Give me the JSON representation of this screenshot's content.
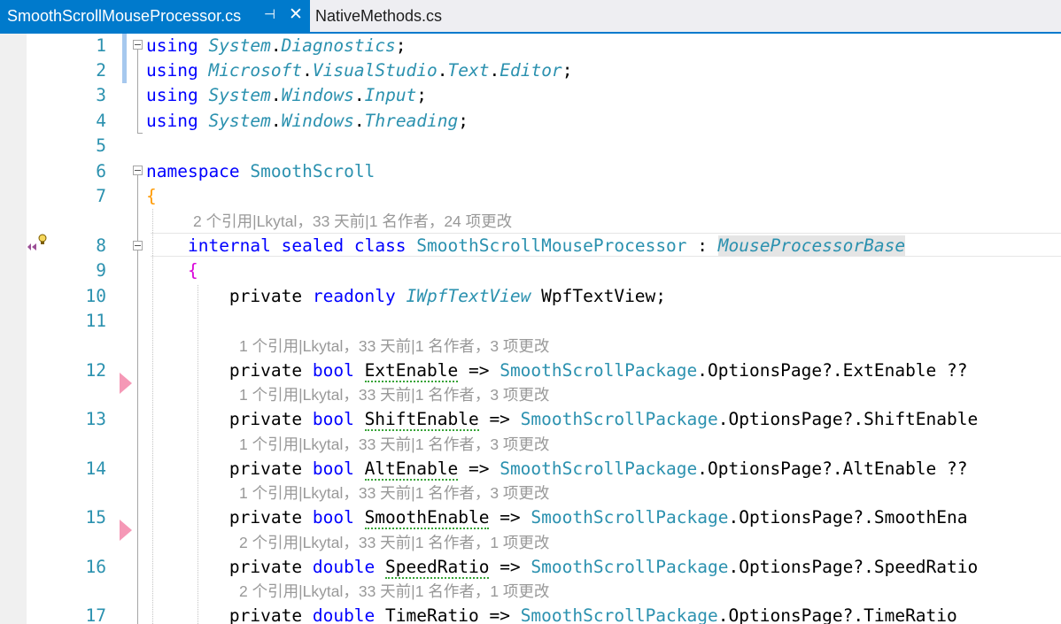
{
  "tabs": [
    {
      "label": "SmoothScrollMouseProcessor.cs",
      "active": true,
      "pin_icon": "pin-icon",
      "close_icon": "close-icon"
    },
    {
      "label": "NativeMethods.cs",
      "active": false
    }
  ],
  "colors": {
    "accent": "#007acc",
    "keyword": "#0000ff",
    "type": "#2b91af",
    "line_number": "#2b91af",
    "brace_namespace": "#ff9900",
    "brace_class": "#d900d9",
    "codelens": "#999999",
    "breakpoint": "#f598b6"
  },
  "codelens": {
    "class": "2 个引用|Lkytal，33 天前|1 名作者，24 项更改",
    "line12": "1 个引用|Lkytal，33 天前|1 名作者，3 项更改",
    "line13": "1 个引用|Lkytal，33 天前|1 名作者，3 项更改",
    "line14": "1 个引用|Lkytal，33 天前|1 名作者，3 项更改",
    "line15": "1 个引用|Lkytal，33 天前|1 名作者，3 项更改",
    "line16": "2 个引用|Lkytal，33 天前|1 名作者，1 项更改",
    "line17": "2 个引用|Lkytal，33 天前|1 名作者，1 项更改"
  },
  "lines": [
    {
      "n": "1",
      "tokens": [
        [
          "kw",
          "using"
        ],
        [
          "p",
          " "
        ],
        [
          "ns",
          "System"
        ],
        [
          "p",
          "."
        ],
        [
          "ns",
          "Diagnostics"
        ],
        [
          "p",
          ";"
        ]
      ]
    },
    {
      "n": "2",
      "tokens": [
        [
          "kw",
          "using"
        ],
        [
          "p",
          " "
        ],
        [
          "ns",
          "Microsoft"
        ],
        [
          "p",
          "."
        ],
        [
          "ns",
          "VisualStudio"
        ],
        [
          "p",
          "."
        ],
        [
          "ns",
          "Text"
        ],
        [
          "p",
          "."
        ],
        [
          "ns",
          "Editor"
        ],
        [
          "p",
          ";"
        ]
      ]
    },
    {
      "n": "3",
      "tokens": [
        [
          "kw",
          "using"
        ],
        [
          "p",
          " "
        ],
        [
          "ns",
          "System"
        ],
        [
          "p",
          "."
        ],
        [
          "ns",
          "Windows"
        ],
        [
          "p",
          "."
        ],
        [
          "ns",
          "Input"
        ],
        [
          "p",
          ";"
        ]
      ]
    },
    {
      "n": "4",
      "tokens": [
        [
          "kw",
          "using"
        ],
        [
          "p",
          " "
        ],
        [
          "ns",
          "System"
        ],
        [
          "p",
          "."
        ],
        [
          "ns",
          "Windows"
        ],
        [
          "p",
          "."
        ],
        [
          "ns",
          "Threading"
        ],
        [
          "p",
          ";"
        ]
      ]
    },
    {
      "n": "5",
      "tokens": []
    },
    {
      "n": "6",
      "tokens": [
        [
          "kw",
          "namespace"
        ],
        [
          "p",
          " "
        ],
        [
          "cls",
          "SmoothScroll"
        ]
      ]
    },
    {
      "n": "7",
      "tokens": [
        [
          "brace-o",
          "{"
        ]
      ]
    },
    {
      "n": "8",
      "tokens": [
        [
          "p",
          "    "
        ],
        [
          "kw",
          "internal"
        ],
        [
          "p",
          " "
        ],
        [
          "kw",
          "sealed"
        ],
        [
          "p",
          " "
        ],
        [
          "kw",
          "class"
        ],
        [
          "p",
          " "
        ],
        [
          "cls",
          "SmoothScrollMouseProcessor"
        ],
        [
          "p",
          " : "
        ],
        [
          "iface hl-base",
          "MouseProcessorBase"
        ]
      ]
    },
    {
      "n": "9",
      "tokens": [
        [
          "p",
          "    "
        ],
        [
          "brace-p",
          "{"
        ]
      ]
    },
    {
      "n": "10",
      "tokens": [
        [
          "p",
          "        private "
        ],
        [
          "kw",
          "readonly"
        ],
        [
          "p",
          " "
        ],
        [
          "iface",
          "IWpfTextView"
        ],
        [
          "p",
          " WpfTextView;"
        ]
      ]
    },
    {
      "n": "11",
      "tokens": []
    },
    {
      "n": "12",
      "tokens": [
        [
          "p",
          "        private "
        ],
        [
          "kw",
          "bool"
        ],
        [
          "p",
          " "
        ],
        [
          "squig",
          "ExtEnable"
        ],
        [
          "p",
          " => "
        ],
        [
          "cls",
          "SmoothScrollPackage"
        ],
        [
          "p",
          ".OptionsPage?.ExtEnable ??"
        ]
      ]
    },
    {
      "n": "13",
      "tokens": [
        [
          "p",
          "        private "
        ],
        [
          "kw",
          "bool"
        ],
        [
          "p",
          " "
        ],
        [
          "squig",
          "ShiftEnable"
        ],
        [
          "p",
          " => "
        ],
        [
          "cls",
          "SmoothScrollPackage"
        ],
        [
          "p",
          ".OptionsPage?.ShiftEnable"
        ]
      ]
    },
    {
      "n": "14",
      "tokens": [
        [
          "p",
          "        private "
        ],
        [
          "kw",
          "bool"
        ],
        [
          "p",
          " "
        ],
        [
          "squig",
          "AltEnable"
        ],
        [
          "p",
          " => "
        ],
        [
          "cls",
          "SmoothScrollPackage"
        ],
        [
          "p",
          ".OptionsPage?.AltEnable ??"
        ]
      ]
    },
    {
      "n": "15",
      "tokens": [
        [
          "p",
          "        private "
        ],
        [
          "kw",
          "bool"
        ],
        [
          "p",
          " "
        ],
        [
          "squig",
          "SmoothEnable"
        ],
        [
          "p",
          " => "
        ],
        [
          "cls",
          "SmoothScrollPackage"
        ],
        [
          "p",
          ".OptionsPage?.SmoothEna"
        ]
      ]
    },
    {
      "n": "16",
      "tokens": [
        [
          "p",
          "        private "
        ],
        [
          "kw",
          "double"
        ],
        [
          "p",
          " "
        ],
        [
          "squig",
          "SpeedRatio"
        ],
        [
          "p",
          " => "
        ],
        [
          "cls",
          "SmoothScrollPackage"
        ],
        [
          "p",
          ".OptionsPage?.SpeedRatio"
        ]
      ]
    },
    {
      "n": "17",
      "tokens": [
        [
          "p",
          "        private "
        ],
        [
          "kw",
          "double"
        ],
        [
          "p",
          " "
        ],
        [
          "squig",
          "TimeRatio"
        ],
        [
          "p",
          " => "
        ],
        [
          "cls",
          "SmoothScrollPackage"
        ],
        [
          "p",
          ".OptionsPage?.TimeRatio"
        ]
      ]
    }
  ]
}
